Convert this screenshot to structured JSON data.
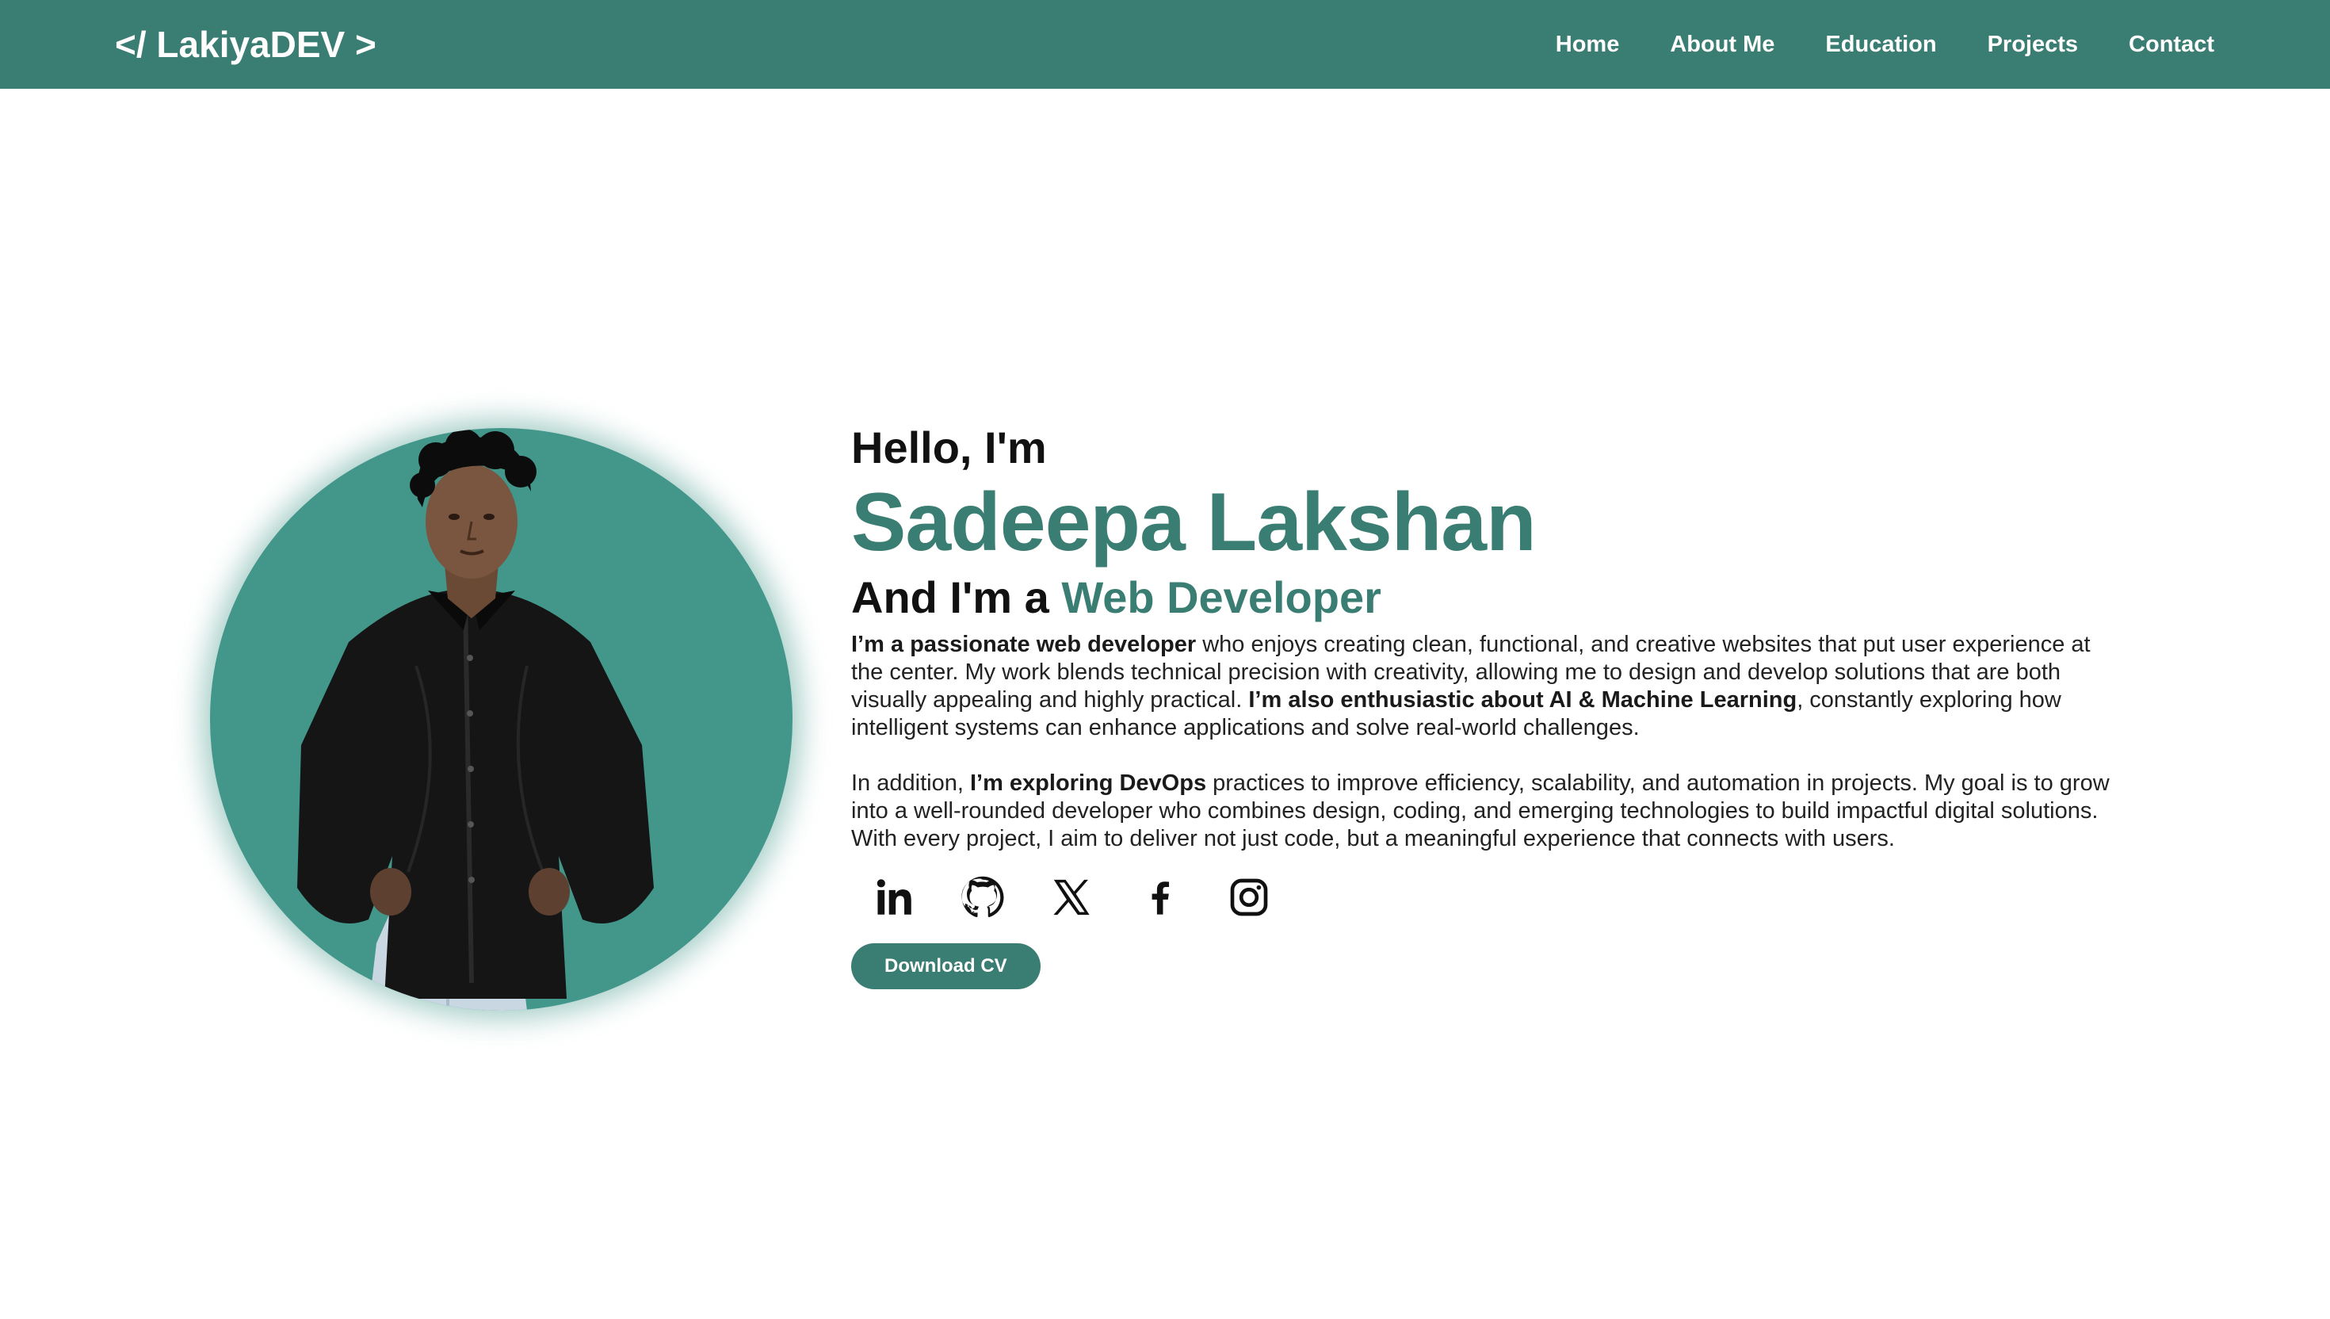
{
  "brand": {
    "logo_text": "</ LakiyaDEV >",
    "primary_color": "#3a7d72",
    "photo_bg_color": "#42968a"
  },
  "nav": {
    "items": [
      {
        "label": "Home"
      },
      {
        "label": "About Me"
      },
      {
        "label": "Education"
      },
      {
        "label": "Projects"
      },
      {
        "label": "Contact"
      }
    ]
  },
  "hero": {
    "greeting": "Hello, I'm",
    "name": "Sadeepa Lakshan",
    "role_prefix": "And I'm a ",
    "role_highlight": "Web Developer",
    "paragraph1": {
      "b1": "I’m a passionate web developer",
      "t1": " who enjoys creating clean, functional, and creative websites that put user experience at the center. My work blends technical precision with creativity, allowing me to design and develop solutions that are both visually appealing and highly practical. ",
      "b2": "I’m also enthusiastic about AI & Machine Learning",
      "t2": ", constantly exploring how intelligent systems can enhance applications and solve real-world challenges."
    },
    "paragraph2": {
      "t1": "In addition, ",
      "b1": "I’m exploring DevOps",
      "t2": " practices to improve efficiency, scalability, and automation in projects. My goal is to grow into a well-rounded developer who combines design, coding, and emerging technologies to build impactful digital solutions. With every project, I aim to deliver not just code, but a meaningful experience that connects with users."
    },
    "socials": [
      {
        "icon": "linkedin-icon"
      },
      {
        "icon": "github-icon"
      },
      {
        "icon": "x-twitter-icon"
      },
      {
        "icon": "facebook-icon"
      },
      {
        "icon": "instagram-icon"
      }
    ],
    "cv_button_label": "Download CV"
  }
}
